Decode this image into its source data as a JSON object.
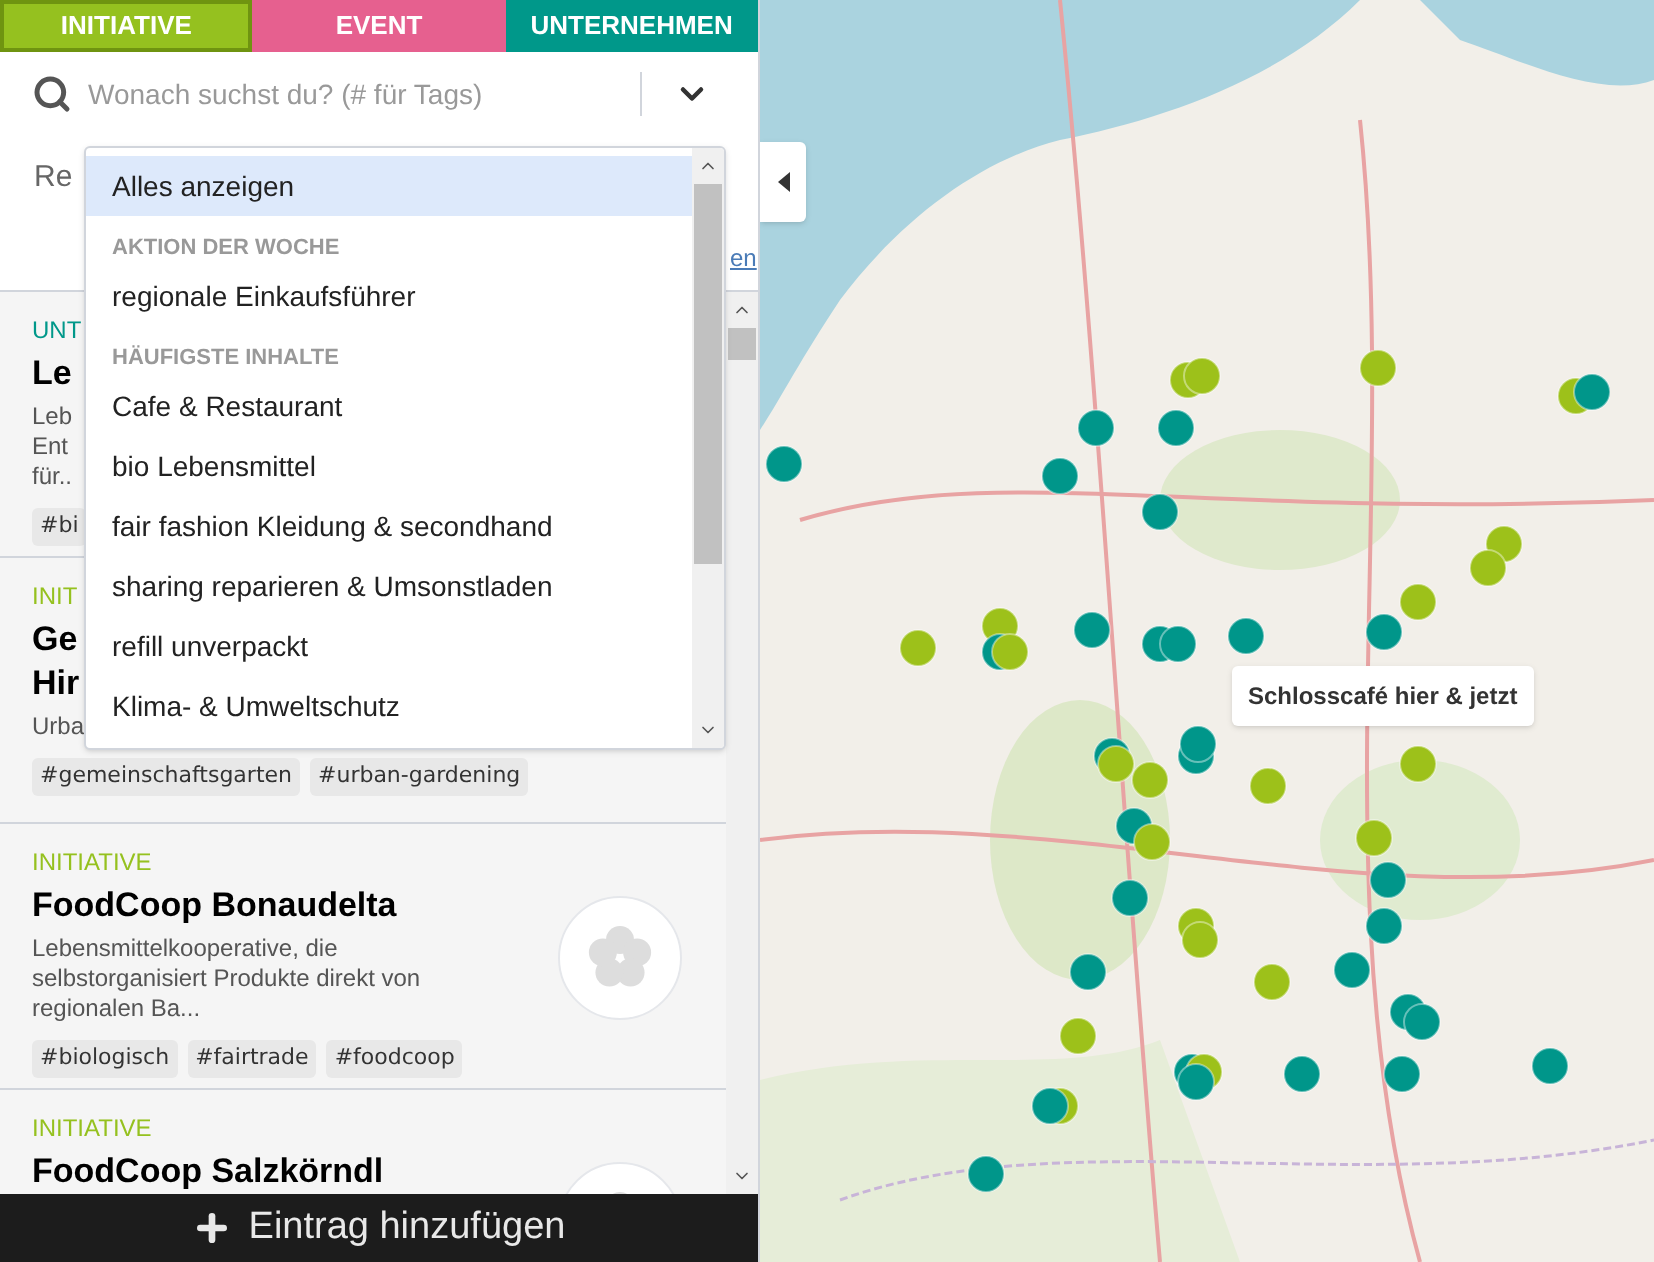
{
  "tabs": [
    {
      "label": "INITIATIVE",
      "color": "#95c11f",
      "selected": true
    },
    {
      "label": "EVENT",
      "color": "#e6608f",
      "selected": false
    },
    {
      "label": "UNTERNEHMEN",
      "color": "#00988a",
      "selected": false
    }
  ],
  "search": {
    "placeholder": "Wonach suchst du? (# für Tags)"
  },
  "region_label": "Re",
  "region_link": "en",
  "dropdown": {
    "options": [
      {
        "kind": "option",
        "label": "Alles anzeigen",
        "selected": true
      },
      {
        "kind": "header",
        "label": "AKTION DER WOCHE"
      },
      {
        "kind": "option",
        "label": "regionale Einkaufsführer",
        "selected": false
      },
      {
        "kind": "header",
        "label": "HÄUFIGSTE INHALTE"
      },
      {
        "kind": "option",
        "label": "Cafe & Restaurant",
        "selected": false
      },
      {
        "kind": "option",
        "label": "bio Lebensmittel",
        "selected": false
      },
      {
        "kind": "option",
        "label": "fair fashion Kleidung & secondhand",
        "selected": false
      },
      {
        "kind": "option",
        "label": "sharing reparieren & Umsonstladen",
        "selected": false
      },
      {
        "kind": "option",
        "label": "refill unverpackt",
        "selected": false
      },
      {
        "kind": "option",
        "label": "Klima- & Umweltschutz",
        "selected": false
      }
    ]
  },
  "entries": [
    {
      "category": "UNT",
      "color": "#00988a",
      "title_lines": [
        "Le"
      ],
      "description_lines": [
        "Leb",
        "Ent",
        "für.."
      ],
      "tags": [
        "#bi"
      ]
    },
    {
      "category": "INIT",
      "color": "#95c11f",
      "title_lines": [
        "Ge",
        "Hir"
      ],
      "description_lines": [
        "Urba"
      ],
      "tags": [
        "#gemeinschaftsgarten",
        "#urban-gardening"
      ]
    },
    {
      "category": "INITIATIVE",
      "color": "#95c11f",
      "title_lines": [
        "FoodCoop Bonaudelta"
      ],
      "description_lines": [
        "Lebensmittelkooperative, die",
        "selbstorganisiert Produkte direkt von",
        "regionalen Ba..."
      ],
      "tags": [
        "#biologisch",
        "#fairtrade",
        "#foodcoop"
      ],
      "image": true
    },
    {
      "category": "INITIATIVE",
      "color": "#95c11f",
      "title_lines": [
        "FoodCoop Salzkörndl"
      ],
      "image": true
    }
  ],
  "add_button": "Eintrag hinzufügen",
  "map": {
    "kind": "picture",
    "tooltip": "Schlosscafé hier & jetzt"
  }
}
